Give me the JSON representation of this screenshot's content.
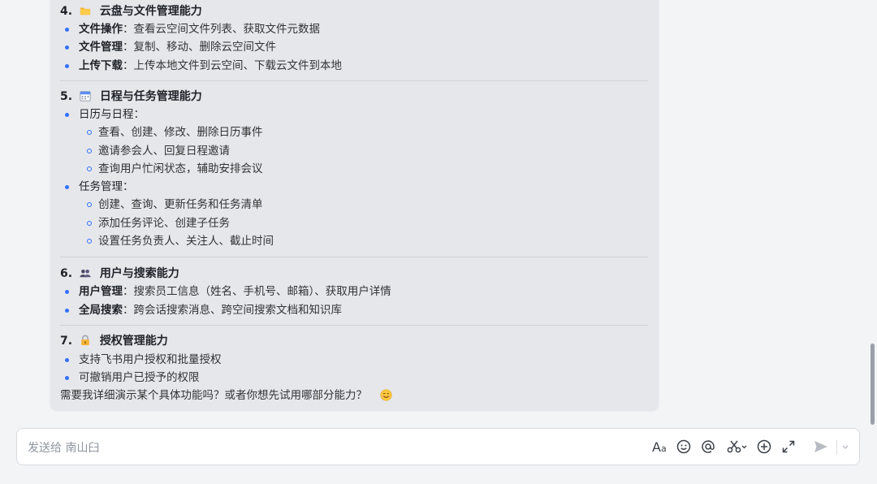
{
  "sections": [
    {
      "num": "4.",
      "title": "云盘与文件管理能力",
      "icon": "folder-icon",
      "items": [
        {
          "label": "文件操作",
          "desc": "：查看云空间文件列表、获取文件元数据"
        },
        {
          "label": "文件管理",
          "desc": "：复制、移动、删除云空间文件"
        },
        {
          "label": "上传下载",
          "desc": "：上传本地文件到云空间、下载云文件到本地"
        }
      ]
    },
    {
      "num": "5.",
      "title": "日程与任务管理能力",
      "icon": "calendar-icon",
      "groups": [
        {
          "label": "日历与日程",
          "suffix": "：",
          "subs": [
            "查看、创建、修改、删除日历事件",
            "邀请参会人、回复日程邀请",
            "查询用户忙闲状态，辅助安排会议"
          ]
        },
        {
          "label": "任务管理",
          "suffix": "：",
          "subs": [
            "创建、查询、更新任务和任务清单",
            "添加任务评论、创建子任务",
            "设置任务负责人、关注人、截止时间"
          ]
        }
      ]
    },
    {
      "num": "6.",
      "title": "用户与搜索能力",
      "icon": "users-icon",
      "items": [
        {
          "label": "用户管理",
          "desc": "：搜索员工信息（姓名、手机号、邮箱）、获取用户详情"
        },
        {
          "label": "全局搜索",
          "desc": "：跨会话搜索消息、跨空间搜索文档和知识库"
        }
      ]
    },
    {
      "num": "7.",
      "title": "授权管理能力",
      "icon": "lock-icon",
      "items": [
        {
          "label": "",
          "desc": "支持飞书用户授权和批量授权"
        },
        {
          "label": "",
          "desc": "可撤销用户已授予的权限"
        }
      ]
    }
  ],
  "closing": "需要我详细演示某个具体功能吗？或者你想先试用哪部分能力？",
  "composer": {
    "placeholder": "发送给 南山臼",
    "format_label": "A",
    "format_sub": "a"
  }
}
